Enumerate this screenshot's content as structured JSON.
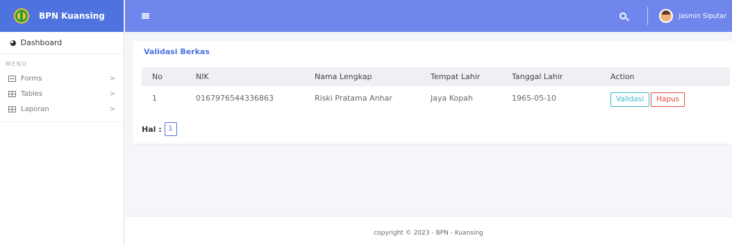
{
  "brand": {
    "name": "BPN Kuansing"
  },
  "sidebar": {
    "dashboard_label": "Dashboard",
    "menu_header": "MENU",
    "items": [
      {
        "label": "Forms",
        "chevron": ">"
      },
      {
        "label": "Tables",
        "chevron": ">"
      },
      {
        "label": "Laporan",
        "chevron": ">"
      }
    ]
  },
  "topbar": {
    "user_name": "Jasmin Siputar"
  },
  "card": {
    "title": "Validasi Berkas",
    "columns": [
      "No",
      "NIK",
      "Nama Lengkap",
      "Tempat Lahir",
      "Tanggal Lahir",
      "Action"
    ],
    "rows": [
      {
        "no": "1",
        "nik": "0167976544336863",
        "nama": "Riski Pratama Anhar",
        "tempat": "Jaya Kopah",
        "tanggal": "1965-05-10",
        "validasi_label": "Validasi",
        "hapus_label": "Hapus"
      }
    ],
    "pager_label": "Hal :",
    "pages": [
      "1"
    ]
  },
  "footer": {
    "text": "copyright © 2023 - BPN - Kuansing"
  },
  "colors": {
    "primary": "#4e73df",
    "topbar": "#6f86ec",
    "info": "#36b9cc",
    "danger": "#e74a3b"
  }
}
